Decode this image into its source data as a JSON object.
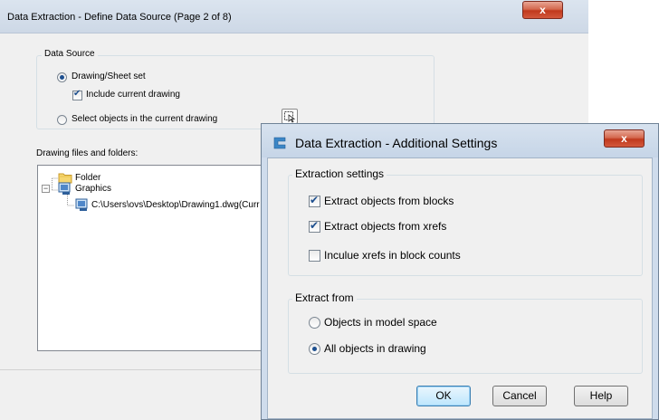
{
  "background_dialog": {
    "title": "Data Extraction - Define Data Source (Page 2 of 8)",
    "close_label": "x",
    "data_source": {
      "legend": "Data Source",
      "option_drawing_sheet_set": "Drawing/Sheet set",
      "include_current_drawing": "Include current drawing",
      "option_select_objects": "Select objects in the current drawing"
    },
    "files_label": "Drawing files and folders:",
    "tree": {
      "folder": "Folder",
      "graphics": "Graphics",
      "drawing": "C:\\Users\\ovs\\Desktop\\Drawing1.dwg(Curr"
    }
  },
  "dialog": {
    "title": "Data Extraction - Additional Settings",
    "close_label": "x",
    "extraction_settings": {
      "legend": "Extraction settings",
      "extract_blocks": "Extract objects from blocks",
      "extract_xrefs": "Extract objects from xrefs",
      "include_xrefs": "Inculue xrefs in block counts"
    },
    "extract_from": {
      "legend": "Extract from",
      "model_space": "Objects in model space",
      "all_objects": "All objects in drawing"
    },
    "buttons": {
      "ok": "OK",
      "cancel": "Cancel",
      "help": "Help"
    }
  },
  "colors": {
    "accent": "#1d4f8f",
    "close_red": "#c0391d",
    "title_bar": "#cdd8e6"
  }
}
